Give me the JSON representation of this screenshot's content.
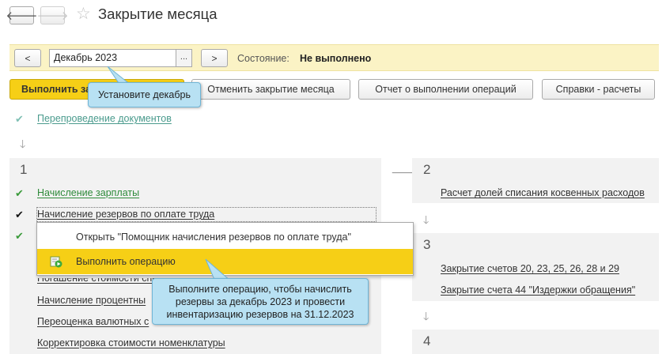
{
  "window": {
    "title": "Закрытие месяца",
    "back_icon": "arrow-left-icon",
    "forward_icon": "arrow-right-icon",
    "favorite_icon": "star-icon"
  },
  "period": {
    "prev_label": "<",
    "next_label": ">",
    "value": "Декабрь 2023",
    "select_label": "...",
    "state_label": "Состояние:",
    "state_value": "Не выполнено"
  },
  "toolbar": {
    "execute_label": "Выполнить за",
    "cancel_label": "Отменить закрытие месяца",
    "report_label": "Отчет о выполнении операций",
    "calc_label": "Справки - расчеты"
  },
  "reposting": {
    "label": "Перепроведение документов"
  },
  "groups": [
    {
      "number": "1",
      "items": [
        {
          "label": "Начисление зарплаты",
          "status": "done"
        },
        {
          "label": "Начисление резервов по оплате труда",
          "status": "pending"
        },
        {
          "label": "Погашение стоимости спецодежды и спецоснастки"
        },
        {
          "label": "Начисление процентны"
        },
        {
          "label": "Переоценка валютных с"
        },
        {
          "label": "Корректировка стоимости номенклатуры"
        }
      ]
    },
    {
      "number": "2",
      "items": [
        {
          "label": "Расчет долей списания косвенных расходов"
        }
      ]
    },
    {
      "number": "3",
      "items": [
        {
          "label": "Закрытие счетов 20, 23, 25, 26, 28 и 29"
        },
        {
          "label": "Закрытие счета 44 \"Издержки обращения\""
        }
      ]
    },
    {
      "number": "4",
      "items": []
    }
  ],
  "context_menu": {
    "items": [
      {
        "label": "Открыть \"Помощник начисления резервов по оплате труда\""
      },
      {
        "label": "Выполнить операцию",
        "icon": "execute-operation-icon"
      }
    ]
  },
  "callouts": {
    "set_december": "Установите декабрь",
    "execute_operation": "Выполните операцию, чтобы начислить резервы за декабрь 2023 и провести инвентаризацию резервов на 31.12.2023"
  },
  "colors": {
    "accent_yellow": "#f6cf16",
    "period_bar": "#fbf3c5",
    "callout_blue": "#b8e1f3",
    "done_green": "#3a9a3a"
  }
}
